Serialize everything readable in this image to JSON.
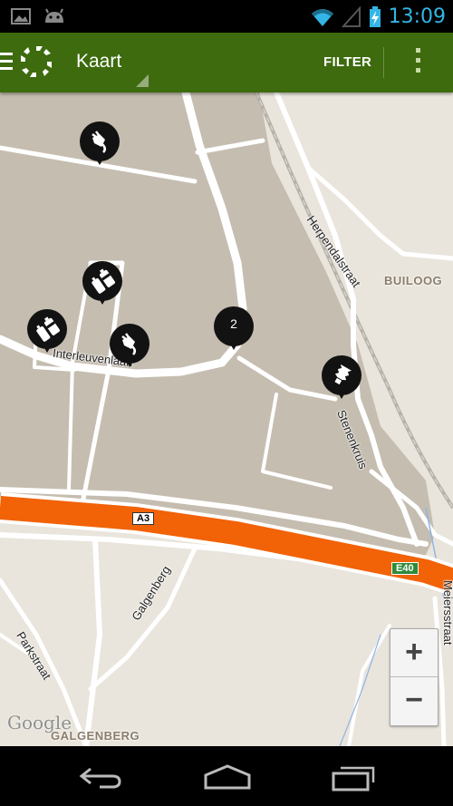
{
  "status_bar": {
    "time": "13:09",
    "icons": [
      "gallery-icon",
      "android-icon",
      "wifi-icon",
      "signal-icon",
      "battery-charging-icon"
    ]
  },
  "action_bar": {
    "title": "Kaart",
    "filter_label": "FILTER",
    "icons": [
      "menu-icon",
      "app-logo-icon",
      "overflow-menu-icon"
    ]
  },
  "map": {
    "street_labels": {
      "interleuvenlaan": "Interleuvenlaan",
      "herpendalstraat": "Herpendalstraat",
      "stenenkruis": "Stenenkruis",
      "galgenberg_street": "Galgenberg",
      "parkstraat": "Parkstraat",
      "meiers": "Meiersstraat"
    },
    "area_labels": {
      "builoog": "BUILOOG",
      "galgenberg_area": "GALGENBERG"
    },
    "road_shields": {
      "a3": "A3",
      "e40": "E40"
    },
    "attribution": "Google",
    "markers": [
      {
        "type": "charger-plug",
        "icon": "plug-icon"
      },
      {
        "type": "batteries",
        "icon": "batteries-icon"
      },
      {
        "type": "batteries",
        "icon": "batteries-icon"
      },
      {
        "type": "charger-plug",
        "icon": "plug-icon"
      },
      {
        "type": "cluster",
        "count": "2"
      },
      {
        "type": "lightbulb",
        "icon": "lightbulb-icon"
      }
    ],
    "zoom": {
      "in_label": "+",
      "out_label": "−"
    }
  },
  "colors": {
    "action_bar": "#3d6b0e",
    "highway": "#f26207",
    "clock": "#33b5e5",
    "zone": "#c5bdb0",
    "map_bg": "#e9e5dc"
  },
  "nav_bar": {
    "icons": [
      "back-icon",
      "home-icon",
      "recent-apps-icon"
    ]
  }
}
